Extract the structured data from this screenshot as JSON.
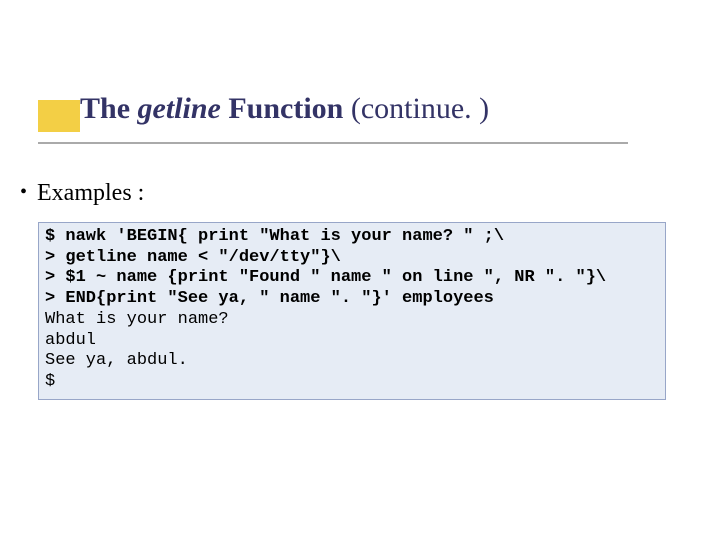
{
  "title": {
    "part1": "The ",
    "part2": "getline",
    "part3": " Function ",
    "part4": "(continue. )"
  },
  "bullet": "Examples :",
  "code": {
    "l1": "$ nawk 'BEGIN{ print \"What is your name? \" ;\\",
    "l2": "> getline name < \"/dev/tty\"}\\",
    "l3": "> $1 ~ name {print \"Found \" name \" on line \", NR \". \"}\\",
    "l4": "> END{print \"See ya, \" name \". \"}' employees",
    "l5": "What is your name?",
    "l6": "abdul",
    "l7": "See ya, abdul.",
    "l8": "$"
  }
}
